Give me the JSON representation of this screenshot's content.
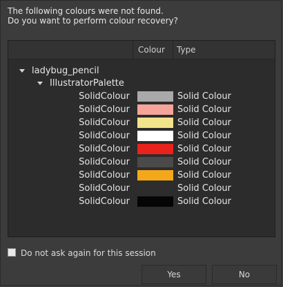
{
  "dialog": {
    "message_line1": "The following colours were not found.",
    "message_line2": "Do you want to perform colour recovery?"
  },
  "table": {
    "columns": {
      "colour": "Colour",
      "type": "Type"
    },
    "tree": {
      "root": "ladybug_pencil",
      "palette": "IllustratorPalette"
    },
    "rows": [
      {
        "name": "SolidColour",
        "type": "Solid Colour",
        "color": "#a9a9a9"
      },
      {
        "name": "SolidColour",
        "type": "Solid Colour",
        "color": "#f6a49a"
      },
      {
        "name": "SolidColour",
        "type": "Solid Colour",
        "color": "#f1e48b"
      },
      {
        "name": "SolidColour",
        "type": "Solid Colour",
        "color": "#ffffff"
      },
      {
        "name": "SolidColour",
        "type": "Solid Colour",
        "color": "#e8231b"
      },
      {
        "name": "SolidColour",
        "type": "Solid Colour",
        "color": "#4a4a4a"
      },
      {
        "name": "SolidColour",
        "type": "Solid Colour",
        "color": "#f3a81b"
      },
      {
        "name": "SolidColour",
        "type": "Solid Colour",
        "color": "#2d2d2d"
      },
      {
        "name": "SolidColour",
        "type": "Solid Colour",
        "color": "#050505"
      }
    ]
  },
  "options": {
    "do_not_ask_label": "Do not ask again for this session",
    "do_not_ask_checked": false
  },
  "buttons": {
    "yes": "Yes",
    "no": "No"
  }
}
